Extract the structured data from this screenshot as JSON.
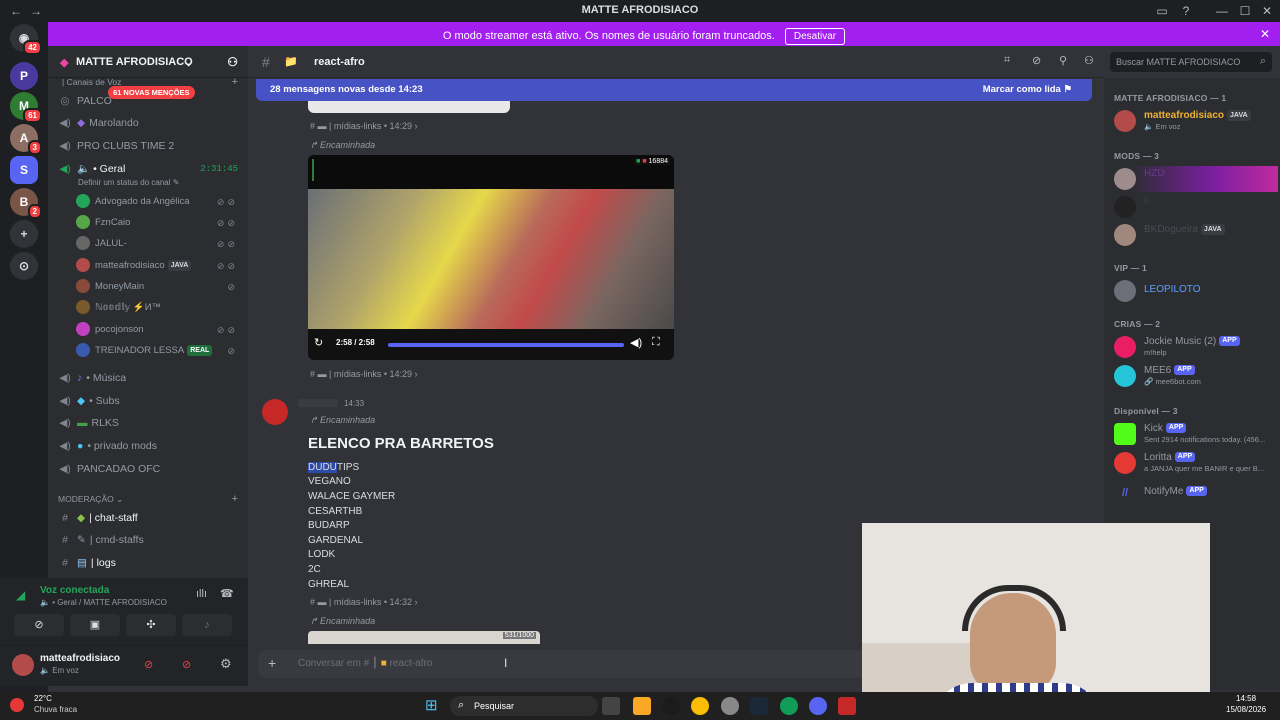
{
  "window": {
    "title": "MATTE AFRODISIACO"
  },
  "banner": {
    "text": "O modo streamer está ativo. Os nomes de usuário foram truncados.",
    "button": "Desativar"
  },
  "guilds": {
    "home_badge": "42",
    "badges": [
      "61",
      "3",
      "2"
    ]
  },
  "server": {
    "name": "MATTE AFRODISIACO"
  },
  "channels": {
    "voice_category": "| Canais de Voz",
    "palco": "PALCO",
    "mentions_badge": "61 NOVAS MENÇÕES",
    "marolando": "Marolando",
    "pro_clubs": "PRO CLUBS TIME 2",
    "geral": "• Geral",
    "geral_timer": "2:31:45",
    "geral_status": "Definir um status do canal",
    "voice_users": [
      {
        "name": "Advogado da Angélica",
        "color": "#23a55a"
      },
      {
        "name": "FznCaio",
        "color": "#57a64a"
      },
      {
        "name": "JALUL-",
        "color": "#666"
      },
      {
        "name": "matteafrodisiaco",
        "color": "#b34b4b",
        "tag": "JAVA"
      },
      {
        "name": "MoneyMain",
        "color": "#8a4a3a"
      },
      {
        "name": "ℕ𝕠𝕠𝕕𝕝𝕪 ⚡И™",
        "color": "#7a5a2a"
      },
      {
        "name": "pocojonson",
        "color": "#c040c0"
      },
      {
        "name": "TREINADOR LESSA",
        "color": "#3a5ab0",
        "tag": "REAL"
      }
    ],
    "musica": "• Música",
    "subs": "• Subs",
    "rlks": "RLKS",
    "privado": "• privado mods",
    "pancadao": "PANCADAO OFC",
    "mod_category": "MODERAÇÃO",
    "chat_staff": "| chat-staff",
    "cmd_staffs": "| cmd-staffs",
    "logs": "| logs"
  },
  "voice_panel": {
    "status": "Voz conectada",
    "location": "• Geral / MATTE AFRODISIACO"
  },
  "user_panel": {
    "name": "matteafrodisiaco",
    "status": "Em voz"
  },
  "chat": {
    "channel": "react-afro",
    "new_messages": "28 mensagens novas desde 14:23",
    "mark_read": "Marcar como lida",
    "msg1_source": "| mídias-links • 14:29",
    "forwarded": "Encaminhada",
    "video_time": "2:58 / 2:58",
    "video_overlay": "16884",
    "msg2_source": "| mídias-links • 14:29",
    "msg3_time": "14:33",
    "msg3_title": "ELENCO PRA BARRETOS",
    "msg3_highlight": "DUDU",
    "msg3_first_rest": "TIPS",
    "msg3_lines": [
      "VEGANO",
      "WALACE GAYMER",
      "CESARTHB",
      "BUDARP",
      "GARDENAL",
      "LODK",
      "2C",
      "GHREAL"
    ],
    "msg3_source": "| mídias-links • 14:32",
    "msg4_forwarded": "Encaminhada",
    "thumb_label": "531/1000",
    "composer_placeholder": "Conversar em #",
    "composer_channel": "react-afro"
  },
  "search": {
    "placeholder": "Buscar MATTE AFRODISIACO"
  },
  "members": {
    "groups": [
      {
        "title": "MATTE AFRODISIACO — 1",
        "items": [
          {
            "name": "matteafrodisiaco",
            "status": "Em voz",
            "tag": "JAVA",
            "color": "#f0b232"
          }
        ]
      },
      {
        "title": "MODS — 3",
        "items": [
          {
            "name": "HZD",
            "status": ""
          },
          {
            "name": "K",
            "status": ""
          },
          {
            "name": "BKDogueira",
            "status": "",
            "tag": "JAVA"
          }
        ]
      },
      {
        "title": "VIP — 1",
        "items": [
          {
            "name": "LEOPILOTO",
            "status": "",
            "color": "#5aa0ff"
          }
        ]
      },
      {
        "title": "CRIAS — 2",
        "items": [
          {
            "name": "Jockie Music (2)",
            "status": "m!help",
            "tag": "APP"
          },
          {
            "name": "MEE6",
            "status": "mee6bot.com",
            "tag": "APP"
          }
        ]
      },
      {
        "title": "Disponível — 3",
        "items": [
          {
            "name": "Kick",
            "status": "Sent 2914 notifications today. (456...",
            "tag": "APP"
          },
          {
            "name": "Loritta",
            "status": "a JANJA quer me BANIR e quer B...",
            "tag": "APP"
          },
          {
            "name": "NotifyMe",
            "status": "",
            "tag": "APP"
          }
        ]
      }
    ]
  },
  "taskbar": {
    "weather_temp": "22°C",
    "weather_desc": "Chuva fraca",
    "search": "Pesquisar",
    "time": "14:58",
    "date": "15/08/2026"
  },
  "colors": {
    "accent": "#a21ff0",
    "blurple": "#5865f2",
    "green": "#23a55a"
  }
}
